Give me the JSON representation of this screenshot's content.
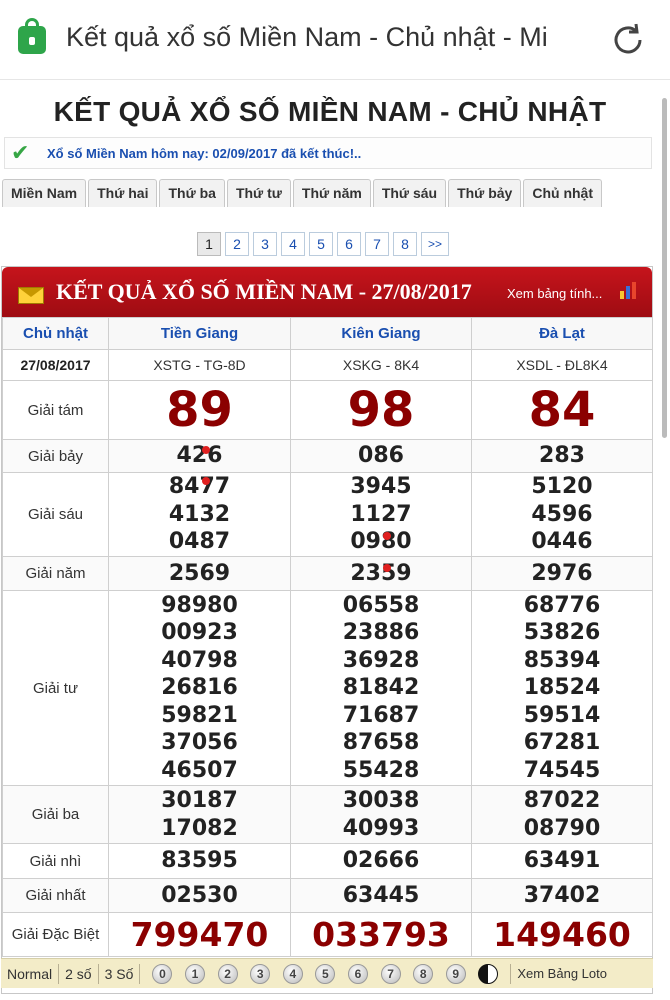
{
  "browser": {
    "url_title": "Kết quả xổ số Miền Nam - Chủ nhật - Mi"
  },
  "page": {
    "title": "KẾT QUẢ XỔ SỐ MIỀN NAM - CHỦ NHẬT",
    "notice": "Xổ số Miền Nam hôm nay: 02/09/2017 đã kết thúc!..",
    "tabs": [
      "Miền Nam",
      "Thứ hai",
      "Thứ ba",
      "Thứ tư",
      "Thứ năm",
      "Thứ sáu",
      "Thứ bảy",
      "Chủ nhật"
    ],
    "pages": [
      "1",
      "2",
      "3",
      "4",
      "5",
      "6",
      "7",
      "8",
      ">>"
    ]
  },
  "results": {
    "title": "KẾT QUẢ XỔ SỐ MIỀN NAM - 27/08/2017",
    "table_link": "Xem bảng tính...",
    "day": "Chủ nhật",
    "date": "27/08/2017",
    "provinces": [
      "Tiền Giang",
      "Kiên Giang",
      "Đà Lạt"
    ],
    "codes": [
      "XSTG - TG-8D",
      "XSKG - 8K4",
      "XSDL - ĐL8K4"
    ],
    "labels": {
      "g8": "Giải tám",
      "g7": "Giải bảy",
      "g6": "Giải sáu",
      "g5": "Giải năm",
      "g4": "Giải tư",
      "g3": "Giải ba",
      "g2": "Giải nhì",
      "g1": "Giải nhất",
      "db": "Giải Đặc Biệt"
    },
    "g8": [
      "89",
      "98",
      "84"
    ],
    "g7": [
      "426",
      "086",
      "283"
    ],
    "g6": [
      [
        "8477",
        "4132",
        "0487"
      ],
      [
        "3945",
        "1127",
        "0980"
      ],
      [
        "5120",
        "4596",
        "0446"
      ]
    ],
    "g5": [
      "2569",
      "2359",
      "2976"
    ],
    "g4": [
      [
        "98980",
        "00923",
        "40798",
        "26816",
        "59821",
        "37056",
        "46507"
      ],
      [
        "06558",
        "23886",
        "36928",
        "81842",
        "71687",
        "87658",
        "55428"
      ],
      [
        "68776",
        "53826",
        "85394",
        "18524",
        "59514",
        "67281",
        "74545"
      ]
    ],
    "g3": [
      [
        "30187",
        "17082"
      ],
      [
        "30038",
        "40993"
      ],
      [
        "87022",
        "08790"
      ]
    ],
    "g2": [
      "83595",
      "02666",
      "63491"
    ],
    "g1": [
      "02530",
      "63445",
      "37402"
    ],
    "db": [
      "799470",
      "033793",
      "149460"
    ]
  },
  "toolbar": {
    "normal": "Normal",
    "two_digits": "2 số",
    "three_digits": "3 Số",
    "digits": [
      "0",
      "1",
      "2",
      "3",
      "4",
      "5",
      "6",
      "7",
      "8",
      "9"
    ],
    "loto": "Xem Bảng Loto"
  },
  "colors": {
    "header_red": "#b3111a",
    "prize_red": "#8b0000",
    "link_blue": "#1a4fb0",
    "lock_green": "#2ea54a"
  }
}
